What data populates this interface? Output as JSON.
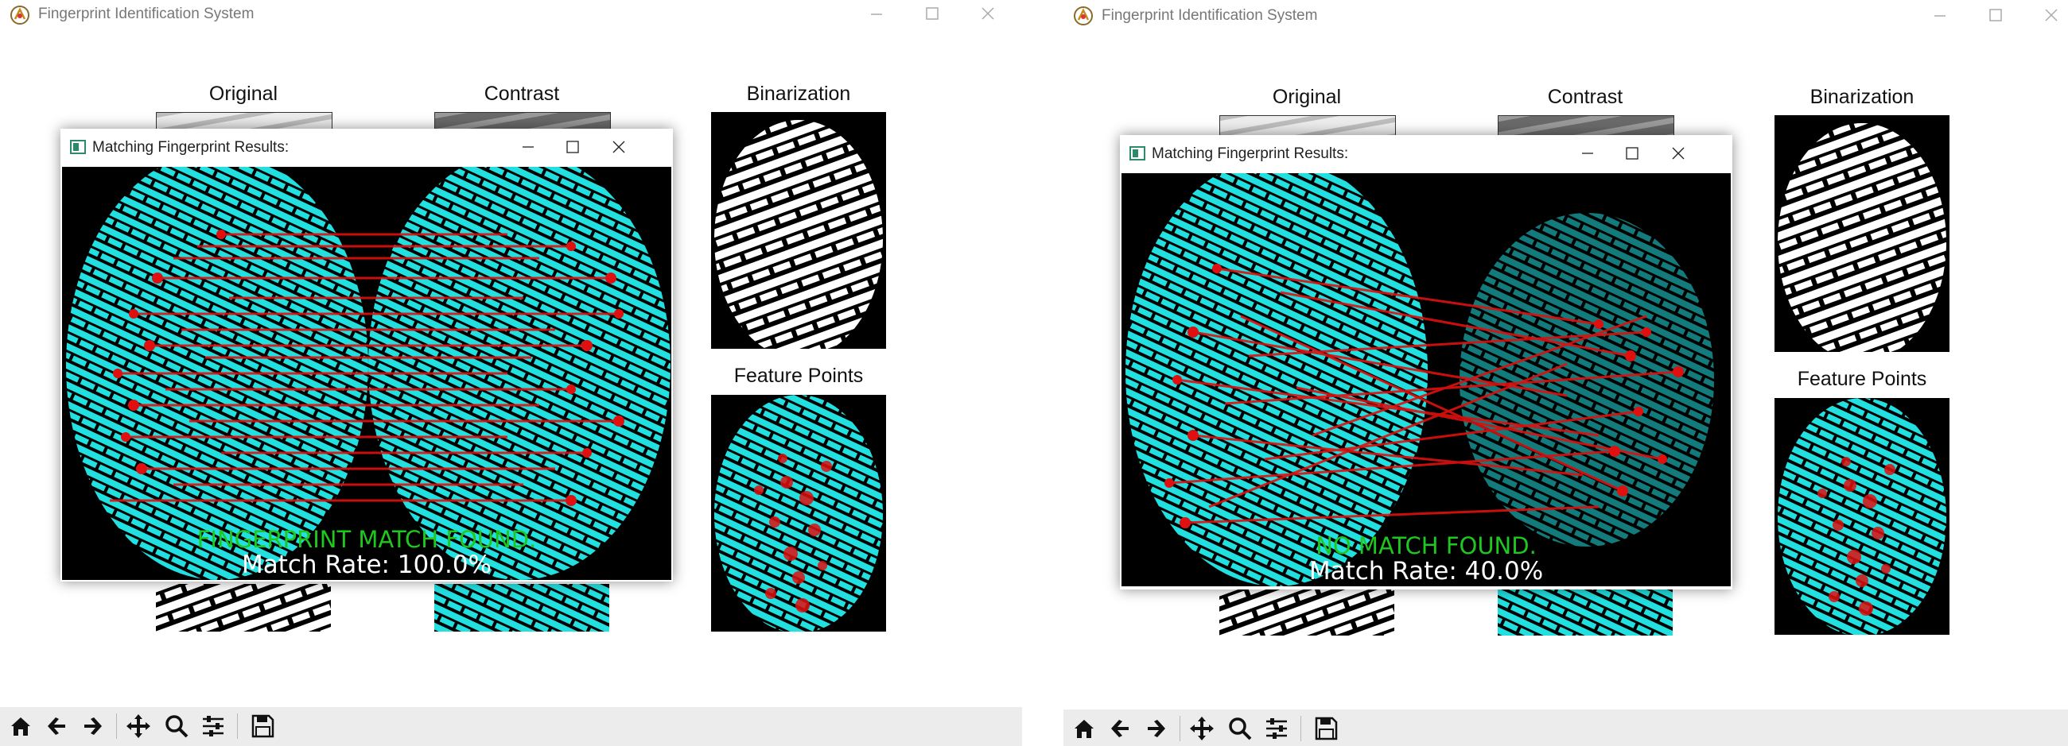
{
  "windows": [
    {
      "title": "Fingerprint Identification System",
      "panels": {
        "original": "Original",
        "contrast": "Contrast",
        "binarization": "Binarization",
        "feature_points": "Feature Points"
      },
      "dialog": {
        "title": "Matching Fingerprint Results:",
        "result": "FINGERPRINT MATCH FOUND.",
        "rate": "Match Rate: 100.0%",
        "result_color": "#1ec81e"
      }
    },
    {
      "title": "Fingerprint Identification System",
      "panels": {
        "original": "Original",
        "contrast": "Contrast",
        "binarization": "Binarization",
        "feature_points": "Feature Points"
      },
      "dialog": {
        "title": "Matching Fingerprint Results:",
        "result": "NO MATCH FOUND.",
        "rate": "Match Rate: 40.0%",
        "result_color": "#1ec81e"
      }
    }
  ],
  "toolbar": [
    "home-icon",
    "back-arrow-icon",
    "forward-arrow-icon",
    "pan-icon",
    "zoom-icon",
    "configure-subplots-icon",
    "save-icon"
  ],
  "colors": {
    "ridge": "#22e0e0",
    "match_line": "#e01010",
    "toolbar_bg": "#ececec"
  }
}
